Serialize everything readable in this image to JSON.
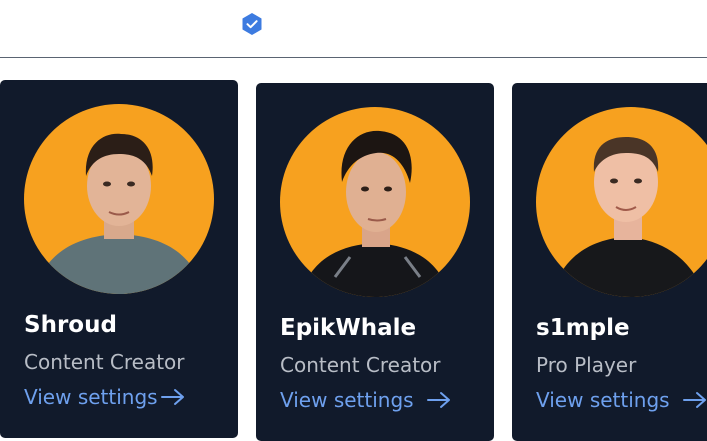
{
  "header": {
    "verified_icon": "verified-badge-icon",
    "accent": "#3d7be0"
  },
  "colors": {
    "card_bg": "#111a2b",
    "avatar_bg": "#f7a11f",
    "link": "#6ea0ee"
  },
  "cards": [
    {
      "name": "Shroud",
      "role": "Content Creator",
      "link_label": "View settings",
      "link_icon": "arrow-right-icon"
    },
    {
      "name": "EpikWhale",
      "role": "Content Creator",
      "link_label": "View settings",
      "link_icon": "arrow-right-icon"
    },
    {
      "name": "s1mple",
      "role": "Pro Player",
      "link_label": "View settings",
      "link_icon": "arrow-right-icon"
    }
  ]
}
